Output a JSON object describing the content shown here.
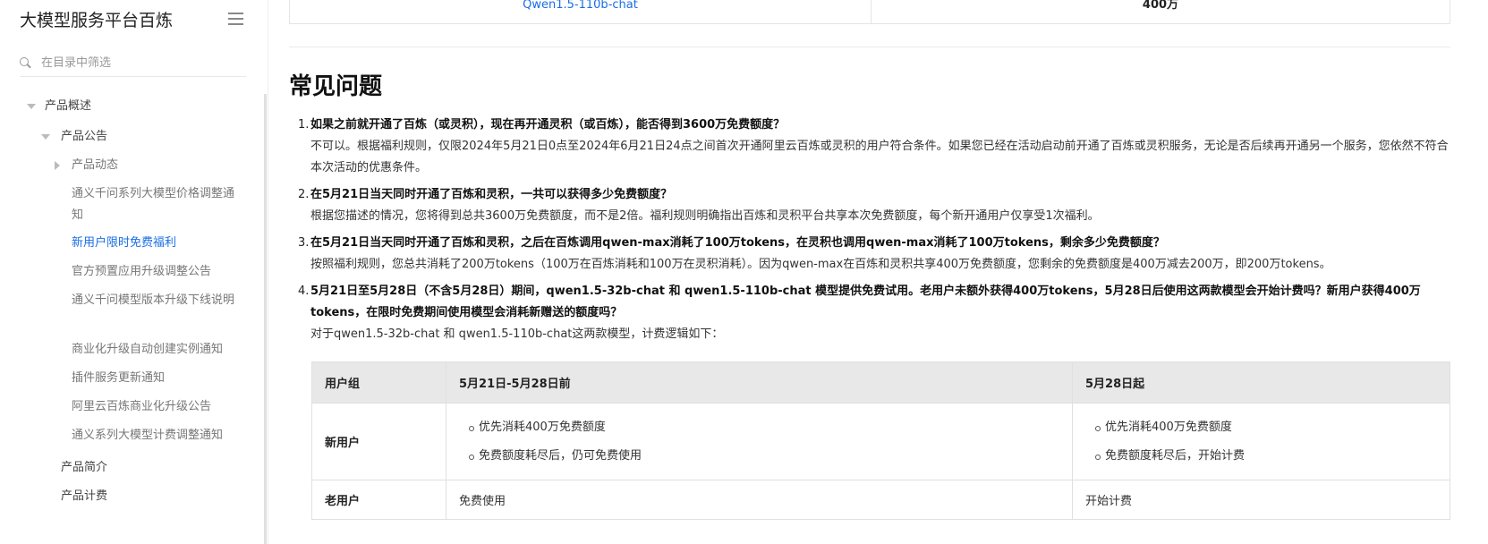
{
  "sidebar": {
    "title": "大模型服务平台百炼",
    "search_placeholder": "在目录中筛选",
    "items": [
      {
        "label": "产品概述"
      },
      {
        "label": "产品公告"
      },
      {
        "label": "产品动态"
      },
      {
        "label": "通义千问系列大模型价格调整通知"
      },
      {
        "label": "新用户限时免费福利"
      },
      {
        "label": "官方预置应用升级调整公告"
      },
      {
        "label": "通义千问模型版本升级下线说明"
      },
      {
        "label": "商业化升级自动创建实例通知"
      },
      {
        "label": "插件服务更新通知"
      },
      {
        "label": "阿里云百炼商业化升级公告"
      },
      {
        "label": "通义系列大模型计费调整通知"
      },
      {
        "label": "产品简介"
      },
      {
        "label": "产品计费"
      }
    ]
  },
  "top_table": {
    "model": "Qwen1.5-110b-chat",
    "value": "400万"
  },
  "faq": {
    "title": "常见问题",
    "items": [
      {
        "num": "1.",
        "question": "如果之前就开通了百炼（或灵积），现在再开通灵积（或百炼），能否得到3600万免费额度？",
        "answer": "不可以。根据福利规则，仅限2024年5月21日0点至2024年6月21日24点之间首次开通阿里云百炼或灵积的用户符合条件。如果您已经在活动启动前开通了百炼或灵积服务，无论是否后续再开通另一个服务，您依然不符合本次活动的优惠条件。"
      },
      {
        "num": "2.",
        "question": "在5月21日当天同时开通了百炼和灵积，一共可以获得多少免费额度？",
        "answer": "根据您描述的情况，您将得到总共3600万免费额度，而不是2倍。福利规则明确指出百炼和灵积平台共享本次免费额度，每个新开通用户仅享受1次福利。"
      },
      {
        "num": "3.",
        "question": "在5月21日当天同时开通了百炼和灵积，之后在百炼调用qwen-max消耗了100万tokens，在灵积也调用qwen-max消耗了100万tokens，剩余多少免费额度？",
        "answer": "按照福利规则，您总共消耗了200万tokens（100万在百炼消耗和100万在灵积消耗）。因为qwen-max在百炼和灵积共享400万免费额度，您剩余的免费额度是400万减去200万，即200万tokens。"
      },
      {
        "num": "4.",
        "question": "5月21日至5月28日（不含5月28日）期间，qwen1.5-32b-chat 和 qwen1.5-110b-chat 模型提供免费试用。老用户未额外获得400万tokens，5月28日后使用这两款模型会开始计费吗？新用户获得400万tokens，在限时免费期间使用模型会消耗新赠送的额度吗？",
        "answer": "对于qwen1.5-32b-chat 和 qwen1.5-110b-chat这两款模型，计费逻辑如下："
      }
    ]
  },
  "fee_table": {
    "headers": [
      "用户组",
      "5月21日-5月28日前",
      "5月28日起"
    ],
    "new_user": {
      "label": "新用户",
      "before": [
        "优先消耗400万免费额度",
        "免费额度耗尽后，仍可免费使用"
      ],
      "after": [
        "优先消耗400万免费额度",
        "免费额度耗尽后，开始计费"
      ]
    },
    "old_user": {
      "label": "老用户",
      "before": "免费使用",
      "after": "开始计费"
    }
  }
}
